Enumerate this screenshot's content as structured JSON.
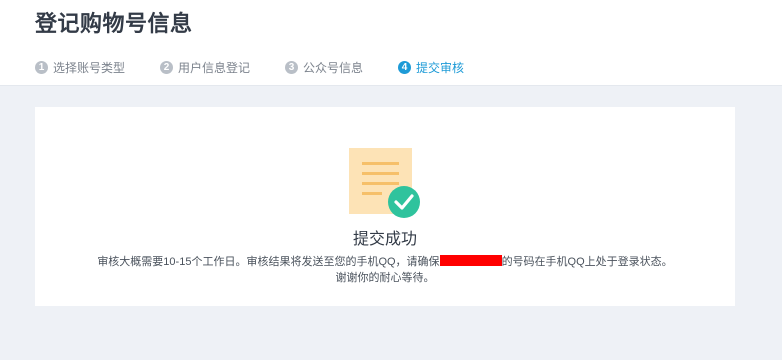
{
  "header": {
    "title": "登记购物号信息",
    "steps": [
      {
        "num": "1",
        "label": "选择账号类型",
        "active": false
      },
      {
        "num": "2",
        "label": "用户信息登记",
        "active": false
      },
      {
        "num": "3",
        "label": "公众号信息",
        "active": false
      },
      {
        "num": "4",
        "label": "提交审核",
        "active": true
      }
    ]
  },
  "result": {
    "icon": "document-check-icon",
    "title": "提交成功",
    "message_before": "审核大概需要10-15个工作日。审核结果将发送至您的手机QQ，请确保",
    "message_after": "的号码在手机QQ上处于登录状态。",
    "message_line2": "谢谢你的耐心等待。"
  },
  "colors": {
    "accent": "#1e9bd7",
    "success": "#2fc39d",
    "doc_paper": "#fde3b6",
    "doc_lines": "#f6c06a",
    "background": "#eef1f6",
    "redaction": "#ff0000"
  }
}
